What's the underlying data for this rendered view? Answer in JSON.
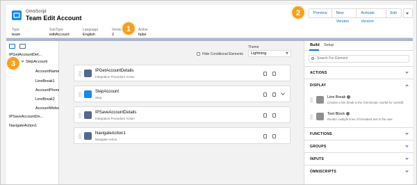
{
  "header": {
    "app_label": "OmniScript",
    "title": "Team Edit Account",
    "meta": [
      {
        "key": "Type",
        "value": "team"
      },
      {
        "key": "SubType",
        "value": "editAccount"
      },
      {
        "key": "Language",
        "value": "English"
      },
      {
        "key": "Version",
        "value": "2"
      },
      {
        "key": "Active",
        "value": "false"
      }
    ],
    "buttons": {
      "preview": "Preview",
      "new_version": "New Version",
      "activate_version": "Activate Version",
      "edit": "Edit"
    }
  },
  "callouts": [
    "1",
    "2",
    "3"
  ],
  "left_panel": {
    "items": [
      "IPGetAccountDet...",
      "StepAccount",
      "AccountName",
      "LineBreak1",
      "AccountPhone",
      "LineBreak2",
      "AccountWebsite",
      "IPSaveAccountDe...",
      "NavigateAction1"
    ]
  },
  "canvas": {
    "hide_conditional": "Hide Conditional Elements",
    "theme_label": "Theme",
    "theme_value": "Lightning",
    "elements": [
      {
        "name": "IPGetAccountDetails",
        "sub": "Integration Procedure Action"
      },
      {
        "name": "StepAccount",
        "sub": "Step"
      },
      {
        "name": "IPSaveAccountDetails",
        "sub": "Integration Procedure Action"
      },
      {
        "name": "NavigateAction1",
        "sub": "Navigate Action"
      }
    ]
  },
  "right_panel": {
    "tabs": [
      "Build",
      "Setup"
    ],
    "search_placeholder": "Search For Element",
    "sections": {
      "actions": "ACTIONS",
      "display": "DISPLAY",
      "functions": "FUNCTIONS",
      "groups": "GROUPS",
      "inputs": "INPUTS",
      "omniscripts": "OMNISCRIPTS"
    },
    "display_items": [
      {
        "name": "Line Break",
        "desc": "Creates a line break in the OmniScript. Useful for controlli"
      },
      {
        "name": "Text Block",
        "desc": "Render multiple lines of formatted text to the user."
      }
    ]
  },
  "colors": {
    "callout": "#f5a21b",
    "brand_blue": "#0070d2",
    "header_bar": "#a8b8ce"
  }
}
